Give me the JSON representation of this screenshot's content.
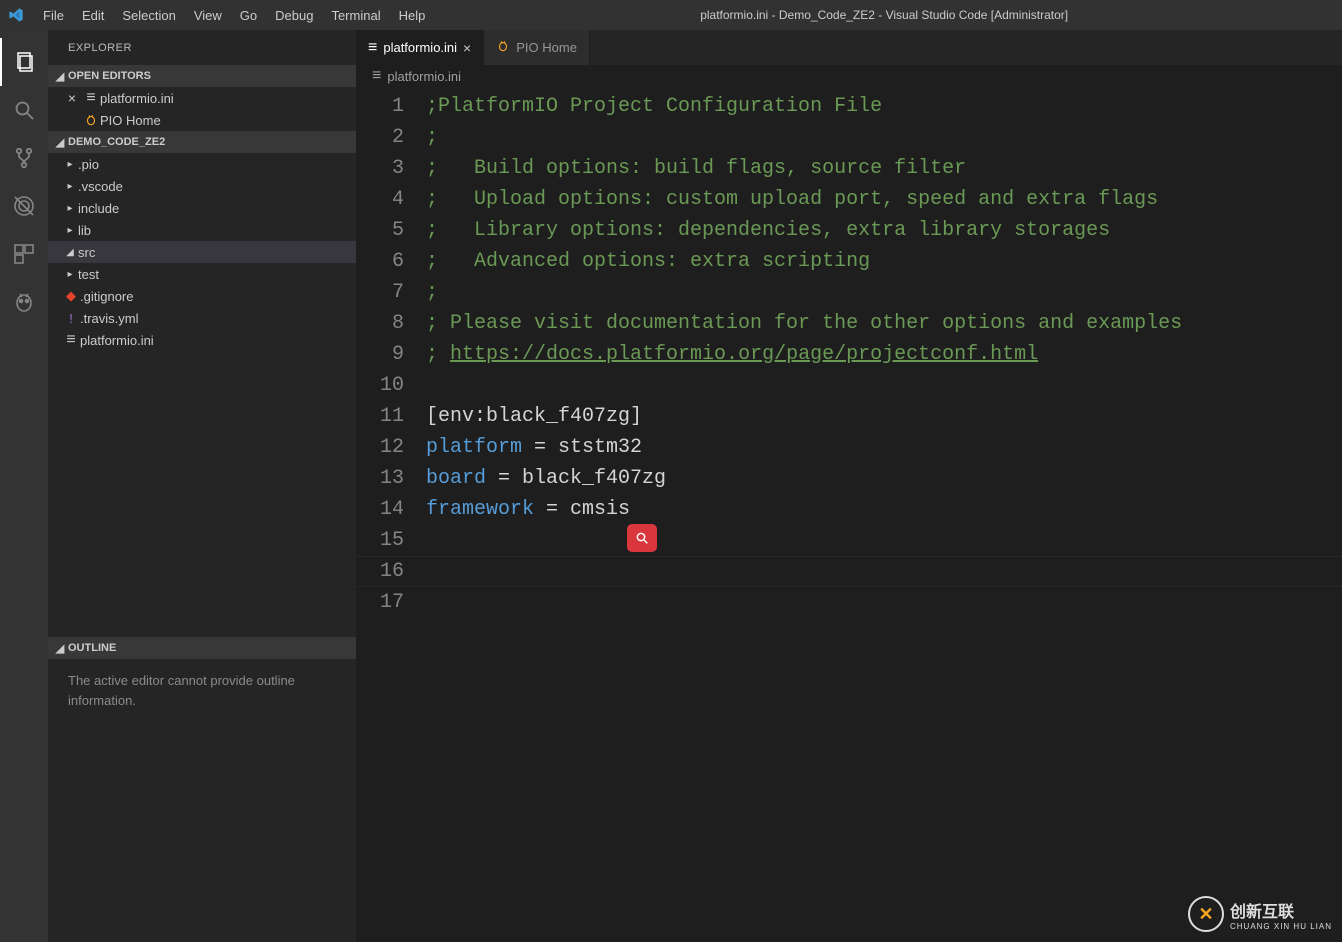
{
  "title": "platformio.ini - Demo_Code_ZE2 - Visual Studio Code [Administrator]",
  "menu": [
    "File",
    "Edit",
    "Selection",
    "View",
    "Go",
    "Debug",
    "Terminal",
    "Help"
  ],
  "sidebar": {
    "title": "EXPLORER",
    "open_editors_label": "OPEN EDITORS",
    "open_editors": [
      {
        "label": "platformio.ini",
        "icon": "settings",
        "dirty": false,
        "close": true
      },
      {
        "label": "PIO Home",
        "icon": "pio",
        "dirty": false,
        "close": false
      }
    ],
    "project_label": "DEMO_CODE_ZE2",
    "tree": [
      {
        "label": ".pio",
        "kind": "folder"
      },
      {
        "label": ".vscode",
        "kind": "folder"
      },
      {
        "label": "include",
        "kind": "folder"
      },
      {
        "label": "lib",
        "kind": "folder"
      },
      {
        "label": "src",
        "kind": "folder",
        "expanded": true
      },
      {
        "label": "test",
        "kind": "folder"
      },
      {
        "label": ".gitignore",
        "kind": "file",
        "icon": "git"
      },
      {
        "label": ".travis.yml",
        "kind": "file",
        "icon": "warn"
      },
      {
        "label": "platformio.ini",
        "kind": "file",
        "icon": "settings"
      }
    ],
    "outline_label": "OUTLINE",
    "outline_msg": "The active editor cannot provide outline information."
  },
  "tabs": [
    {
      "label": "platformio.ini",
      "icon": "settings",
      "active": true,
      "close": true
    },
    {
      "label": "PIO Home",
      "icon": "pio",
      "active": false,
      "close": false
    }
  ],
  "breadcrumb": "platformio.ini",
  "code": {
    "lines": [
      {
        "n": 1,
        "segs": [
          {
            "t": ";PlatformIO Project Configuration File",
            "c": "tk-comment"
          }
        ]
      },
      {
        "n": 2,
        "segs": [
          {
            "t": ";",
            "c": "tk-comment"
          }
        ]
      },
      {
        "n": 3,
        "segs": [
          {
            "t": ";   Build options: build flags, source filter",
            "c": "tk-comment"
          }
        ]
      },
      {
        "n": 4,
        "segs": [
          {
            "t": ";   Upload options: custom upload port, speed and extra flags",
            "c": "tk-comment"
          }
        ]
      },
      {
        "n": 5,
        "segs": [
          {
            "t": ";   Library options: dependencies, extra library storages",
            "c": "tk-comment"
          }
        ]
      },
      {
        "n": 6,
        "segs": [
          {
            "t": ";   Advanced options: extra scripting",
            "c": "tk-comment"
          }
        ]
      },
      {
        "n": 7,
        "segs": [
          {
            "t": ";",
            "c": "tk-comment"
          }
        ]
      },
      {
        "n": 8,
        "segs": [
          {
            "t": "; Please visit documentation for the other options and examples",
            "c": "tk-comment"
          }
        ]
      },
      {
        "n": 9,
        "segs": [
          {
            "t": "; ",
            "c": "tk-comment"
          },
          {
            "t": "https://docs.platformio.org/page/projectconf.html",
            "c": "tk-link"
          }
        ]
      },
      {
        "n": 10,
        "segs": []
      },
      {
        "n": 11,
        "segs": [
          {
            "t": "[env:black_f407zg]",
            "c": "tk-section"
          }
        ]
      },
      {
        "n": 12,
        "segs": [
          {
            "t": "platform",
            "c": "tk-key"
          },
          {
            "t": " = ",
            "c": "tk-eq"
          },
          {
            "t": "ststm32",
            "c": "tk-val"
          }
        ]
      },
      {
        "n": 13,
        "segs": [
          {
            "t": "board",
            "c": "tk-key"
          },
          {
            "t": " = ",
            "c": "tk-eq"
          },
          {
            "t": "black_f407zg",
            "c": "tk-val"
          }
        ]
      },
      {
        "n": 14,
        "segs": [
          {
            "t": "framework",
            "c": "tk-key"
          },
          {
            "t": " = ",
            "c": "tk-eq"
          },
          {
            "t": "cmsis",
            "c": "tk-val"
          }
        ]
      },
      {
        "n": 15,
        "segs": []
      },
      {
        "n": 16,
        "segs": [],
        "current": true
      },
      {
        "n": 17,
        "segs": []
      }
    ]
  },
  "watermark": {
    "brand": "创新互联",
    "sub": "CHUANG XIN HU LIAN"
  }
}
